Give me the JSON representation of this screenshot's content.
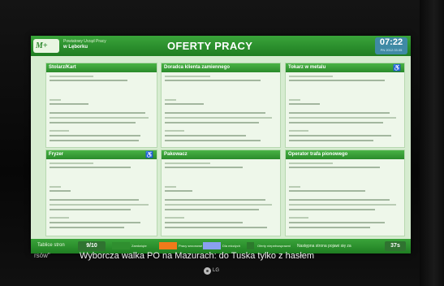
{
  "header": {
    "logo_text": "M+",
    "office_line1": "Powiatowy Urząd Pracy",
    "office_line2": "w Lęborku",
    "title": "OFERTY PRACY",
    "clock": "07:22",
    "date": "PN 2012.03.05"
  },
  "offers": [
    {
      "title": "Stolarz/Kart",
      "wheelchair": false
    },
    {
      "title": "Doradca klienta zamiennego",
      "wheelchair": false
    },
    {
      "title": "Tokarz w metalu",
      "wheelchair": true
    },
    {
      "title": "Fryzer",
      "wheelchair": true
    },
    {
      "title": "Pakowacz",
      "wheelchair": false
    },
    {
      "title": "Operator trafa pionowego",
      "wheelchair": false
    }
  ],
  "status": {
    "label": "Tablice stron",
    "pages": "9/10",
    "legend": [
      {
        "label": "Zamknięte",
        "color": "#2f8f2f"
      },
      {
        "label": "Pracy sezonowe",
        "color": "#f07a1a"
      },
      {
        "label": "Dla młodych",
        "color": "#8aa0f0"
      },
      {
        "label": "Oferty niepełnosprawni",
        "color": "#2c7a2c"
      }
    ],
    "next_label": "Następna strona pojawi się za",
    "timer": "37s"
  },
  "caption": {
    "source": "rsów\"",
    "text": "Wyborcza walka PO na Mazurach: do Tuska tylko z hasłem"
  },
  "tv_brand": "LG"
}
